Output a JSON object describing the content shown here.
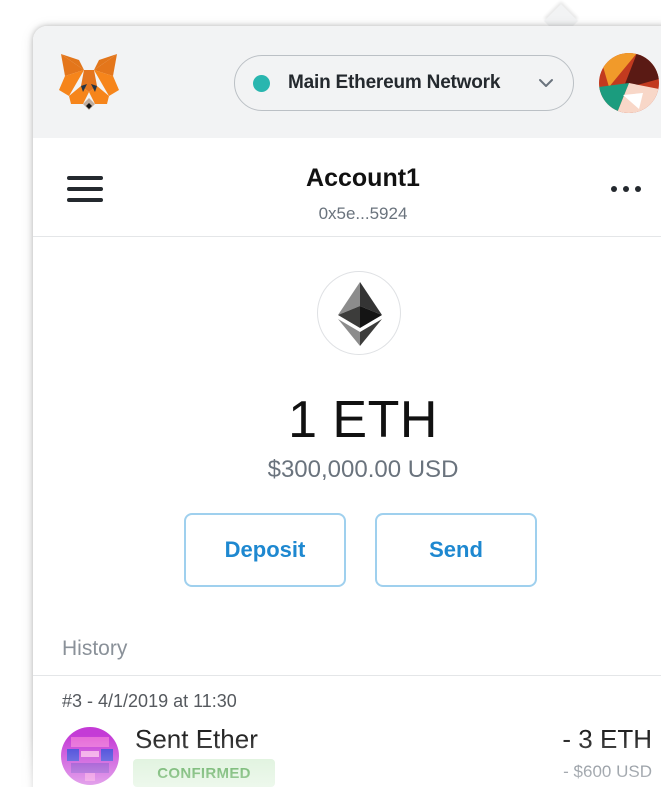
{
  "header": {
    "network_label": "Main Ethereum Network",
    "network_status_color": "#29b6af",
    "fox_icon": "metamask-fox-logo",
    "chevron_icon": "chevron-down-icon",
    "avatar_icon": "account-identicon"
  },
  "account": {
    "menu_icon": "hamburger-menu-icon",
    "name": "Account1",
    "address_short": "0x5e...5924",
    "more_icon": "more-options-icon"
  },
  "wallet": {
    "token_icon": "ethereum-icon",
    "balance": "1 ETH",
    "balance_fiat": "$300,000.00 USD",
    "accent_color": "#1e88d0"
  },
  "actions": {
    "deposit_label": "Deposit",
    "send_label": "Send"
  },
  "history": {
    "heading": "History",
    "transactions": [
      {
        "meta": "#3 - 4/1/2019 at 11:30",
        "title": "Sent Ether",
        "status": "CONFIRMED",
        "amount": "- 3 ETH",
        "fiat": "- $600 USD"
      }
    ]
  }
}
